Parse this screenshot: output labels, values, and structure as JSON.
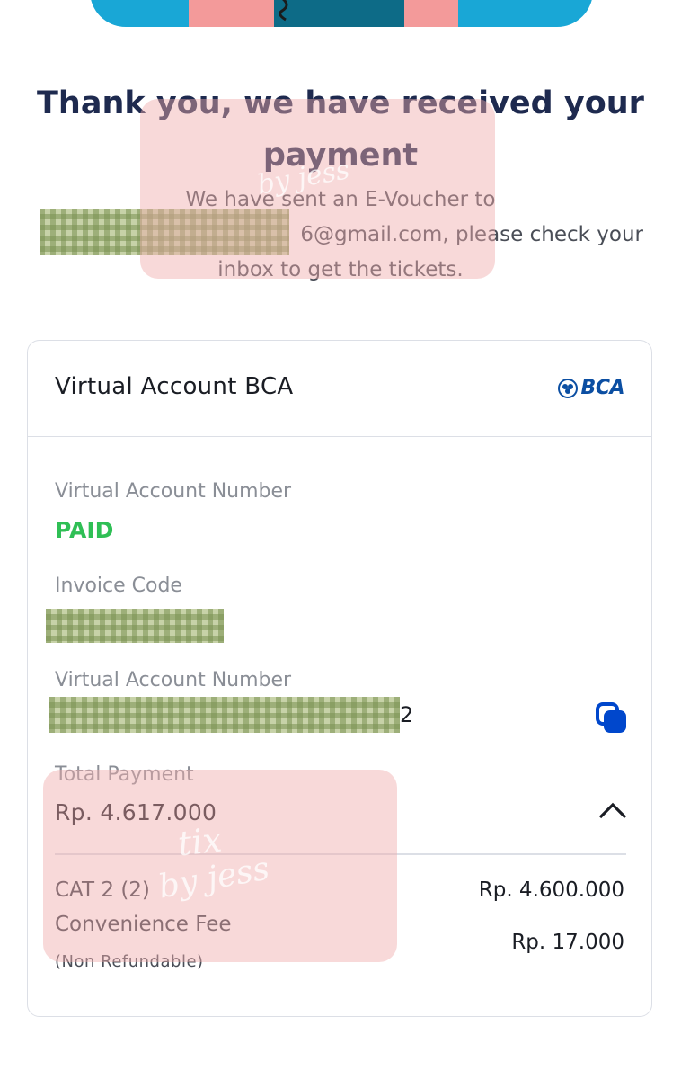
{
  "header": {
    "title": "Thank you, we have received your payment",
    "subtitle_line1": "We have sent an E-Voucher to",
    "subtitle_line2": "6@gmail.com, please check your",
    "subtitle_line3": "inbox to get the tickets."
  },
  "card": {
    "method": "Virtual Account BCA",
    "bank_logo_text": "BCA",
    "status_label": "Virtual Account Number",
    "status_value": "PAID",
    "invoice_label": "Invoice Code",
    "va_label": "Virtual Account Number",
    "va_trailing": "2",
    "total_label": "Total Payment",
    "total_value": "Rp. 4.617.000",
    "items": [
      {
        "name": "CAT 2 (2)",
        "amount": "Rp. 4.600.000"
      },
      {
        "name": "Convenience Fee",
        "note": "(Non Refundable)",
        "amount": "Rp. 17.000"
      }
    ]
  },
  "watermark": {
    "line1": "tix",
    "line2": "by jess"
  },
  "colors": {
    "accent_blue": "#0b4ea2",
    "paid_green": "#2fbf55",
    "title_navy": "#1e2a4f"
  },
  "icons": {
    "copy": "copy-icon",
    "collapse": "chevron-up-icon",
    "logo": "bca-logo-icon"
  }
}
